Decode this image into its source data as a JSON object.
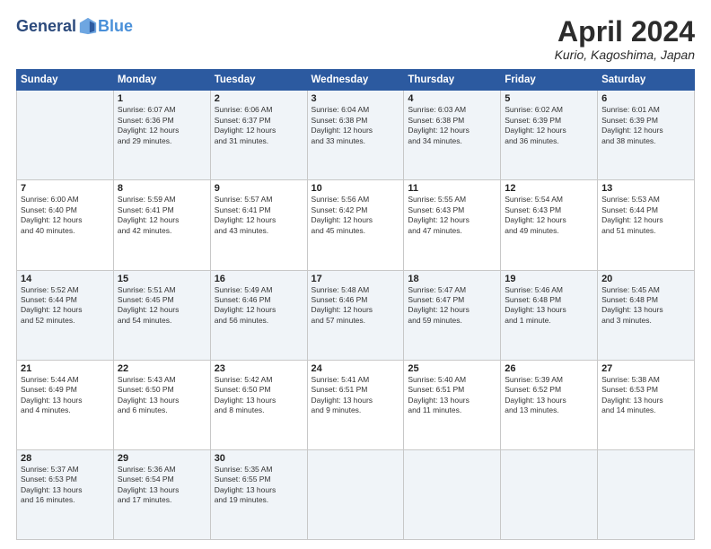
{
  "header": {
    "logo_general": "General",
    "logo_blue": "Blue",
    "title": "April 2024",
    "location": "Kurio, Kagoshima, Japan"
  },
  "weekdays": [
    "Sunday",
    "Monday",
    "Tuesday",
    "Wednesday",
    "Thursday",
    "Friday",
    "Saturday"
  ],
  "weeks": [
    [
      {
        "day": "",
        "info": ""
      },
      {
        "day": "1",
        "info": "Sunrise: 6:07 AM\nSunset: 6:36 PM\nDaylight: 12 hours\nand 29 minutes."
      },
      {
        "day": "2",
        "info": "Sunrise: 6:06 AM\nSunset: 6:37 PM\nDaylight: 12 hours\nand 31 minutes."
      },
      {
        "day": "3",
        "info": "Sunrise: 6:04 AM\nSunset: 6:38 PM\nDaylight: 12 hours\nand 33 minutes."
      },
      {
        "day": "4",
        "info": "Sunrise: 6:03 AM\nSunset: 6:38 PM\nDaylight: 12 hours\nand 34 minutes."
      },
      {
        "day": "5",
        "info": "Sunrise: 6:02 AM\nSunset: 6:39 PM\nDaylight: 12 hours\nand 36 minutes."
      },
      {
        "day": "6",
        "info": "Sunrise: 6:01 AM\nSunset: 6:39 PM\nDaylight: 12 hours\nand 38 minutes."
      }
    ],
    [
      {
        "day": "7",
        "info": "Sunrise: 6:00 AM\nSunset: 6:40 PM\nDaylight: 12 hours\nand 40 minutes."
      },
      {
        "day": "8",
        "info": "Sunrise: 5:59 AM\nSunset: 6:41 PM\nDaylight: 12 hours\nand 42 minutes."
      },
      {
        "day": "9",
        "info": "Sunrise: 5:57 AM\nSunset: 6:41 PM\nDaylight: 12 hours\nand 43 minutes."
      },
      {
        "day": "10",
        "info": "Sunrise: 5:56 AM\nSunset: 6:42 PM\nDaylight: 12 hours\nand 45 minutes."
      },
      {
        "day": "11",
        "info": "Sunrise: 5:55 AM\nSunset: 6:43 PM\nDaylight: 12 hours\nand 47 minutes."
      },
      {
        "day": "12",
        "info": "Sunrise: 5:54 AM\nSunset: 6:43 PM\nDaylight: 12 hours\nand 49 minutes."
      },
      {
        "day": "13",
        "info": "Sunrise: 5:53 AM\nSunset: 6:44 PM\nDaylight: 12 hours\nand 51 minutes."
      }
    ],
    [
      {
        "day": "14",
        "info": "Sunrise: 5:52 AM\nSunset: 6:44 PM\nDaylight: 12 hours\nand 52 minutes."
      },
      {
        "day": "15",
        "info": "Sunrise: 5:51 AM\nSunset: 6:45 PM\nDaylight: 12 hours\nand 54 minutes."
      },
      {
        "day": "16",
        "info": "Sunrise: 5:49 AM\nSunset: 6:46 PM\nDaylight: 12 hours\nand 56 minutes."
      },
      {
        "day": "17",
        "info": "Sunrise: 5:48 AM\nSunset: 6:46 PM\nDaylight: 12 hours\nand 57 minutes."
      },
      {
        "day": "18",
        "info": "Sunrise: 5:47 AM\nSunset: 6:47 PM\nDaylight: 12 hours\nand 59 minutes."
      },
      {
        "day": "19",
        "info": "Sunrise: 5:46 AM\nSunset: 6:48 PM\nDaylight: 13 hours\nand 1 minute."
      },
      {
        "day": "20",
        "info": "Sunrise: 5:45 AM\nSunset: 6:48 PM\nDaylight: 13 hours\nand 3 minutes."
      }
    ],
    [
      {
        "day": "21",
        "info": "Sunrise: 5:44 AM\nSunset: 6:49 PM\nDaylight: 13 hours\nand 4 minutes."
      },
      {
        "day": "22",
        "info": "Sunrise: 5:43 AM\nSunset: 6:50 PM\nDaylight: 13 hours\nand 6 minutes."
      },
      {
        "day": "23",
        "info": "Sunrise: 5:42 AM\nSunset: 6:50 PM\nDaylight: 13 hours\nand 8 minutes."
      },
      {
        "day": "24",
        "info": "Sunrise: 5:41 AM\nSunset: 6:51 PM\nDaylight: 13 hours\nand 9 minutes."
      },
      {
        "day": "25",
        "info": "Sunrise: 5:40 AM\nSunset: 6:51 PM\nDaylight: 13 hours\nand 11 minutes."
      },
      {
        "day": "26",
        "info": "Sunrise: 5:39 AM\nSunset: 6:52 PM\nDaylight: 13 hours\nand 13 minutes."
      },
      {
        "day": "27",
        "info": "Sunrise: 5:38 AM\nSunset: 6:53 PM\nDaylight: 13 hours\nand 14 minutes."
      }
    ],
    [
      {
        "day": "28",
        "info": "Sunrise: 5:37 AM\nSunset: 6:53 PM\nDaylight: 13 hours\nand 16 minutes."
      },
      {
        "day": "29",
        "info": "Sunrise: 5:36 AM\nSunset: 6:54 PM\nDaylight: 13 hours\nand 17 minutes."
      },
      {
        "day": "30",
        "info": "Sunrise: 5:35 AM\nSunset: 6:55 PM\nDaylight: 13 hours\nand 19 minutes."
      },
      {
        "day": "",
        "info": ""
      },
      {
        "day": "",
        "info": ""
      },
      {
        "day": "",
        "info": ""
      },
      {
        "day": "",
        "info": ""
      }
    ]
  ]
}
